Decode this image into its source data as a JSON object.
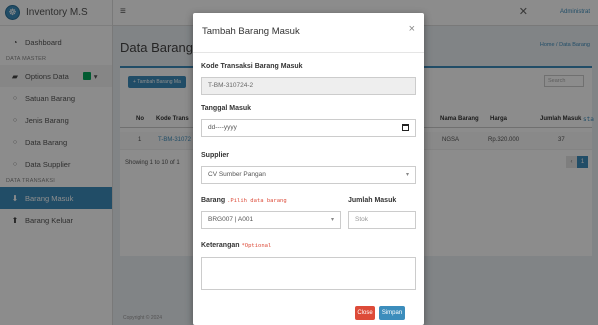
{
  "app": {
    "brand": "Inventory M.S",
    "logo_glyph": "☸"
  },
  "topbar": {
    "menu_icon": "≡",
    "close_glyph": "✕",
    "user": "Administrat"
  },
  "sidebar": {
    "dashboard": "Dashboard",
    "master_header": "DATA MASTER",
    "options": "Options Data",
    "items": [
      "Satuan Barang",
      "Jenis Barang",
      "Data Barang",
      "Data Supplier"
    ],
    "transaksi_header": "DATA TRANSAKSI",
    "barang_masuk": "Barang Masuk",
    "barang_keluar": "Barang Keluar"
  },
  "page": {
    "title": "Data Barang I",
    "breadcrumb": "Home / Data Barang",
    "add_button": "+ Tambah Barang Ma",
    "search_placeholder": "Search",
    "columns": {
      "no": "No",
      "kode": "Kode Trans",
      "nama": "Nama Barang",
      "harga": "Harga",
      "jumlah": "Jumlah Masuk",
      "satuan": "sta"
    },
    "row": {
      "no": "1",
      "kode": "T-BM-31072",
      "nama": "NGSA",
      "harga": "Rp.320.000",
      "jumlah": "37"
    },
    "showing": "Showing 1 to 10 of 1",
    "pager": {
      "prev": "‹",
      "current": "1"
    },
    "footer": "Copyright © 2024"
  },
  "modal": {
    "title": "Tambah Barang Masuk",
    "close_glyph": "×",
    "kode_label": "Kode Transaksi Barang Masuk",
    "kode_value": "T-BM-310724-2",
    "tanggal_label": "Tanggal Masuk",
    "tanggal_placeholder": "dd----yyyy",
    "supplier_label": "Supplier",
    "supplier_value": "CV Sumber Pangan",
    "barang_label": "Barang",
    "barang_hint": ".Pilih data barang",
    "barang_value": "BRG007 | A001",
    "jumlah_label": "Jumlah Masuk",
    "jumlah_placeholder": "Stok",
    "keterangan_label": "Keterangan",
    "keterangan_hint": "*Optional",
    "close_button": "Close",
    "save_button": "Simpan"
  },
  "colors": {
    "primary": "#3c8dbc",
    "danger": "#dd4b39",
    "success": "#00a65a"
  }
}
